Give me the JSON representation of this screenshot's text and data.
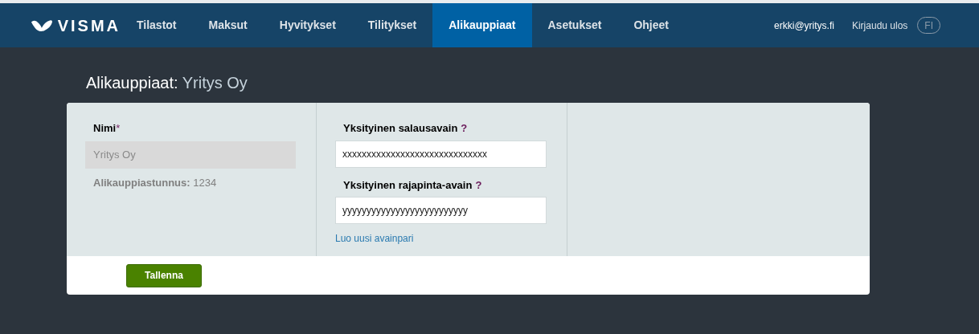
{
  "header": {
    "logo": "VISMA",
    "nav": [
      {
        "label": "Tilastot",
        "selected": false
      },
      {
        "label": "Maksut",
        "selected": false
      },
      {
        "label": "Hyvitykset",
        "selected": false
      },
      {
        "label": "Tilitykset",
        "selected": false
      },
      {
        "label": "Alikauppiaat",
        "selected": true
      },
      {
        "label": "Asetukset",
        "selected": false
      },
      {
        "label": "Ohjeet",
        "selected": false
      }
    ],
    "user": "erkki@yritys.fi",
    "logout": "Kirjaudu ulos",
    "language": "FI"
  },
  "page": {
    "title": "Alikauppiaat:",
    "subtitle": "Yritys Oy"
  },
  "form": {
    "name_label": "Nimi",
    "required_mark": "*",
    "name_value": "Yritys Oy",
    "id_label": "Alikauppiastunnus:",
    "id_value": "1234",
    "keys": [
      {
        "label": "Yksityinen salausavain",
        "help": "?",
        "value": "xxxxxxxxxxxxxxxxxxxxxxxxxxxxxx"
      },
      {
        "label": "Yksityinen rajapinta-avain",
        "help": "?",
        "value": "yyyyyyyyyyyyyyyyyyyyyyyyyy"
      }
    ],
    "generate_link": "Luo uusi avainpari",
    "save_button": "Tallenna"
  }
}
